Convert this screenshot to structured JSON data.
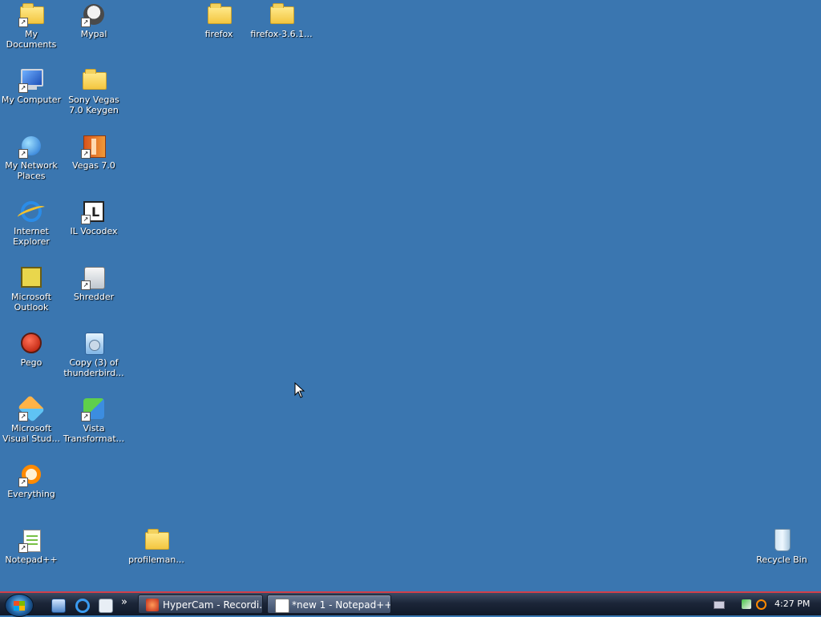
{
  "desktop": {
    "icons": [
      {
        "label": "My\nDocuments",
        "icon": "folder-shortcut-icon"
      },
      {
        "label": "Mypal",
        "icon": "raccoon-browser-icon"
      },
      {
        "label": "firefox",
        "icon": "folder-icon"
      },
      {
        "label": "firefox-3.6.1...",
        "icon": "folder-icon"
      },
      {
        "label": "My Computer",
        "icon": "computer-icon"
      },
      {
        "label": "Sony Vegas\n7.0 Keygen",
        "icon": "folder-icon"
      },
      {
        "label": "My Network\nPlaces",
        "icon": "network-places-icon"
      },
      {
        "label": "Vegas 7.0",
        "icon": "vegas-icon"
      },
      {
        "label": "Internet\nExplorer",
        "icon": "internet-explorer-icon"
      },
      {
        "label": "IL Vocodex",
        "icon": "il-vocodex-icon"
      },
      {
        "label": "Microsoft\nOutlook",
        "icon": "outlook-icon"
      },
      {
        "label": "Shredder",
        "icon": "shredder-icon"
      },
      {
        "label": "Pego",
        "icon": "pego-icon"
      },
      {
        "label": "Copy (3) of\nthunderbird...",
        "icon": "thunderbird-setup-icon"
      },
      {
        "label": "Microsoft\nVisual Stud...",
        "icon": "visual-studio-icon"
      },
      {
        "label": "Vista\nTransformat...",
        "icon": "vista-transformation-icon"
      },
      {
        "label": "Everything",
        "icon": "everything-search-icon"
      },
      {
        "label": "Notepad++",
        "icon": "notepad-plus-plus-icon"
      },
      {
        "label": "profileman...",
        "icon": "folder-icon"
      },
      {
        "label": "Recycle Bin",
        "icon": "recycle-bin-icon"
      }
    ]
  },
  "taskbar": {
    "start_icon": "windows-start-orb-icon",
    "quick_launch": [
      "show-desktop-icon",
      "internet-explorer-icon",
      "mail-icon"
    ],
    "quick_launch_more": "»",
    "buttons": [
      {
        "label": "HyperCam - Recordi...",
        "icon": "hypercam-icon"
      },
      {
        "label": "*new 1 - Notepad++",
        "icon": "notepad-plus-plus-icon"
      }
    ],
    "tray": {
      "icons": [
        "keyboard-icon",
        "network-icon",
        "search-icon"
      ],
      "clock": "4:27 PM"
    }
  },
  "colors": {
    "desktop_background": "#3a76b0",
    "taskbar": "#1c2638",
    "taskbar_border": "#d0404a"
  }
}
